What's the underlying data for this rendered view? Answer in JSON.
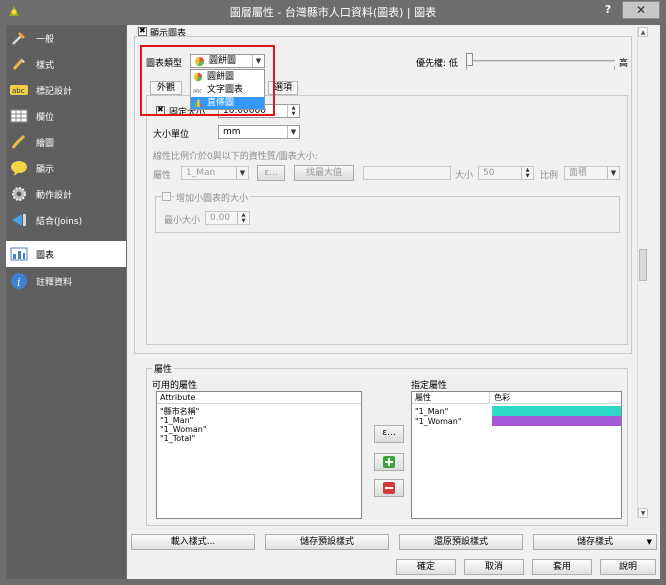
{
  "window": {
    "title": "圖層屬性 - 台灣縣市人口資料(圖表) | 圖表",
    "help": "?",
    "close": "✕"
  },
  "sidebar": {
    "items": [
      {
        "label": "一般",
        "icon": "wrench-icon"
      },
      {
        "label": "樣式",
        "icon": "paintbrush-icon"
      },
      {
        "label": "標記設計",
        "icon": "abc-label-icon"
      },
      {
        "label": "欄位",
        "icon": "table-icon"
      },
      {
        "label": "繪圖",
        "icon": "brush-icon"
      },
      {
        "label": "顯示",
        "icon": "speech-bubble-icon"
      },
      {
        "label": "動作設計",
        "icon": "gear-icon"
      },
      {
        "label": "結合(Joins)",
        "icon": "join-icon"
      },
      {
        "label": "圖表",
        "icon": "chart-icon"
      },
      {
        "label": "註釋資料",
        "icon": "info-icon"
      }
    ],
    "active_index": 8
  },
  "main": {
    "display_chart_label": "顯示圖表",
    "chart_type_label": "圖表類型",
    "chart_type_value": "圓餅圖",
    "priority_label": "優先權: 低",
    "priority_high": "高",
    "priority_level": 0.0,
    "dropdown_items": [
      {
        "label": "圓餅圖",
        "icon": "pie-chart-icon"
      },
      {
        "label": "文字圖表",
        "icon": "text-chart-icon"
      },
      {
        "label": "直條圖",
        "icon": "bar-chart-icon"
      }
    ],
    "dropdown_selected": 2,
    "tabs": {
      "appearance": "外觀",
      "options": "選項"
    },
    "fixed_size_label": "固定大小",
    "fixed_size_value": "10.00000",
    "size_unit_label": "大小單位",
    "size_unit_value": "mm",
    "linear_scale_label": "線性比例介於0與以下的資性質/圖表大小:",
    "attribute_label": "屬性",
    "attribute_value": "1_Man",
    "expr_button": "ε...",
    "find_max_button": "找最大值",
    "size_label": "大小",
    "size_value": "50",
    "scale_label": "比例",
    "scale_value": "面積",
    "increase_small_label": "增加小圖表的大小",
    "min_size_label": "最小大小",
    "min_size_value": "0.00",
    "attributes_group": "屬性",
    "available_label": "可用的屬性",
    "available_header": "Attribute",
    "available_items": [
      "\"縣市名稱\"",
      "\"1_Man\"",
      "\"1_Woman\"",
      "\"1_Total\""
    ],
    "assigned_label": "指定屬性",
    "assigned_header_attr": "屬性",
    "assigned_header_color": "色彩",
    "assigned_items": [
      {
        "attr": "\"1_Man\"",
        "color": "#2ed8c8"
      },
      {
        "attr": "\"1_Woman\"",
        "color": "#a25ad6"
      }
    ],
    "expr_button2": "ε..."
  },
  "footer": {
    "load_style": "載入樣式...",
    "save_default": "儲存預設樣式",
    "restore_default": "還原預設樣式",
    "save_style": "儲存樣式",
    "ok": "確定",
    "cancel": "取消",
    "apply": "套用",
    "help": "說明"
  },
  "colors": {
    "add": "#3aa53a",
    "remove": "#d33b3b",
    "selection": "#3399ff",
    "highlight": "#e0161b"
  }
}
